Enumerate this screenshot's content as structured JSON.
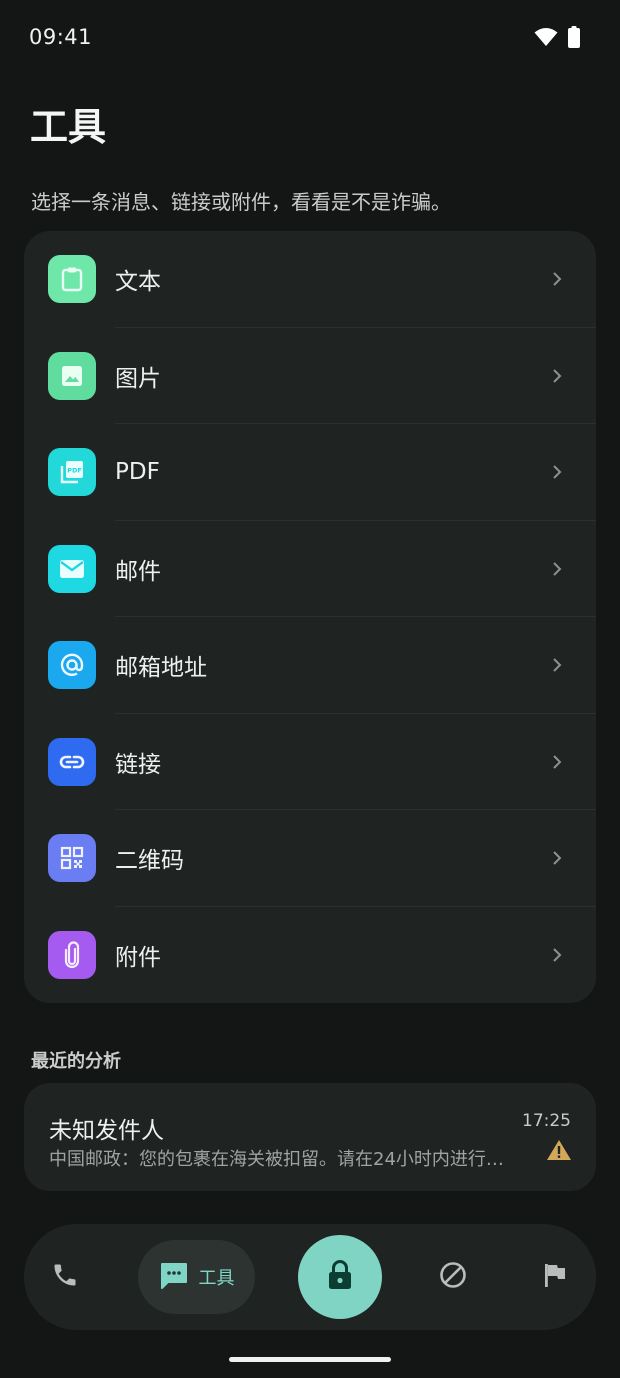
{
  "status_bar": {
    "time": "09:41"
  },
  "page": {
    "title": "工具",
    "subtitle": "选择一条消息、链接或附件，看看是不是诈骗。"
  },
  "tools": [
    {
      "label": "文本",
      "icon": "clipboard-icon",
      "color": "#6ee7a8"
    },
    {
      "label": "图片",
      "icon": "image-icon",
      "color": "#5fdc9e"
    },
    {
      "label": "PDF",
      "icon": "pdf-icon",
      "color": "#22d8d8"
    },
    {
      "label": "邮件",
      "icon": "mail-icon",
      "color": "#1ed9e2"
    },
    {
      "label": "邮箱地址",
      "icon": "at-icon",
      "color": "#1aa8ee"
    },
    {
      "label": "链接",
      "icon": "link-icon",
      "color": "#2f6bf0"
    },
    {
      "label": "二维码",
      "icon": "qr-code-icon",
      "color": "#6a7df2"
    },
    {
      "label": "附件",
      "icon": "paperclip-icon",
      "color": "#a55bef"
    }
  ],
  "recent": {
    "heading": "最近的分析",
    "items": [
      {
        "sender": "未知发件人",
        "preview": "中国邮政：您的包裹在海关被扣留。请在24小时内进行…",
        "time": "17:25",
        "status_icon": "warning-icon",
        "status_color": "#d4a85a"
      }
    ]
  },
  "nav": {
    "items": [
      {
        "name": "phone",
        "icon": "phone-icon"
      },
      {
        "name": "tools",
        "icon": "message-icon",
        "label": "工具",
        "active": true
      },
      {
        "name": "lock",
        "icon": "lock-icon"
      },
      {
        "name": "block",
        "icon": "block-icon"
      },
      {
        "name": "report",
        "icon": "flag-icon"
      }
    ]
  },
  "colors": {
    "background": "#141615",
    "card": "#1f2322",
    "accent": "#80d4c3"
  }
}
